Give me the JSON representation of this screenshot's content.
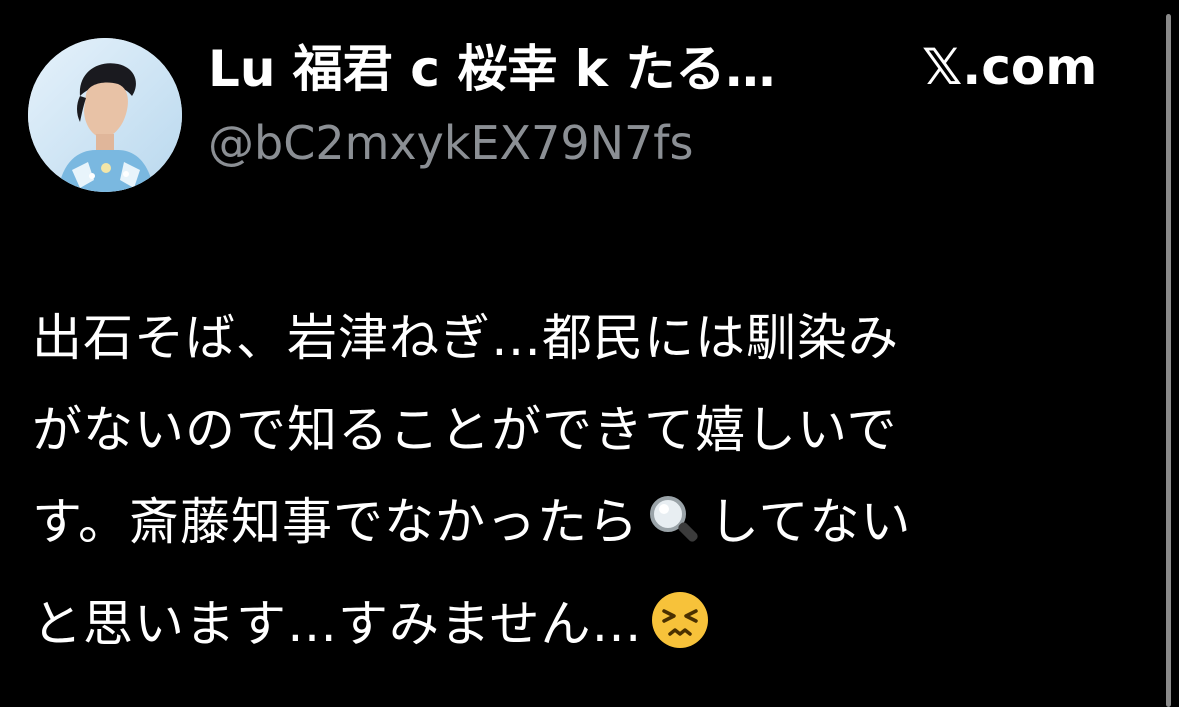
{
  "post": {
    "display_name": "Lu 福君 c 桜幸 k たる…",
    "handle": "@bC2mxykEX79N7fs",
    "site_label": "𝕏.com",
    "body_lines": [
      "出石そば、岩津ねぎ…都民には馴染み",
      "がないので知ることができて嬉しいで",
      "す。斎藤知事でなかったら",
      "してない",
      "と思います…すみません…"
    ]
  },
  "icons": {
    "avatar": "profile-photo-skater",
    "magnifier": "magnifying-glass-emoji",
    "face": "persevering-face-emoji"
  },
  "colors": {
    "background": "#000000",
    "text": "#ffffff",
    "handle": "#8b8f94",
    "scrollbar": "#8a8a8a"
  }
}
